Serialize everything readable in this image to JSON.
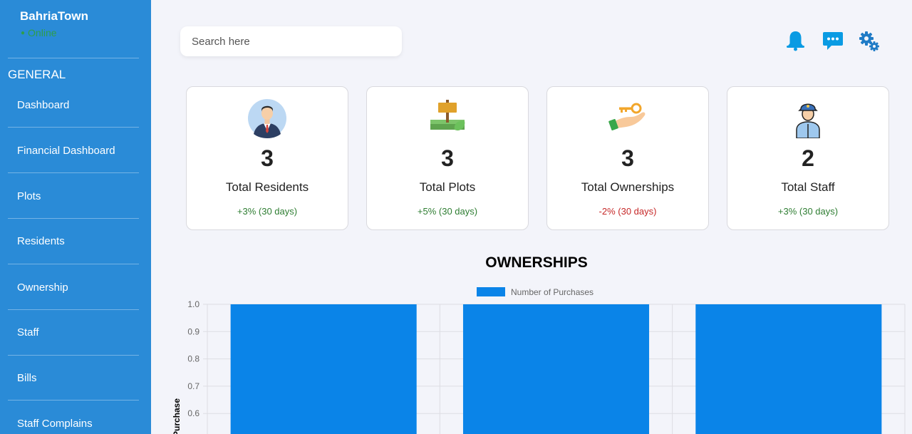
{
  "sidebar": {
    "brand": "BahriaTown",
    "status": "Online",
    "section": "GENERAL",
    "items": [
      {
        "label": "Dashboard"
      },
      {
        "label": "Financial Dashboard"
      },
      {
        "label": "Plots"
      },
      {
        "label": "Residents"
      },
      {
        "label": "Ownership"
      },
      {
        "label": "Staff"
      },
      {
        "label": "Bills"
      },
      {
        "label": "Staff Complains"
      }
    ]
  },
  "header": {
    "search_placeholder": "Search here",
    "icons": [
      "bell-icon",
      "chat-icon",
      "gears-icon"
    ],
    "icon_color": "#0a9be3"
  },
  "stats": [
    {
      "value": "3",
      "label": "Total Residents",
      "change": "+3% (30 days)",
      "trend": "up",
      "icon": "resident-avatar-icon"
    },
    {
      "value": "3",
      "label": "Total Plots",
      "change": "+5% (30 days)",
      "trend": "up",
      "icon": "plot-sign-icon"
    },
    {
      "value": "3",
      "label": "Total Ownerships",
      "change": "-2% (30 days)",
      "trend": "down",
      "icon": "hand-key-icon"
    },
    {
      "value": "2",
      "label": "Total Staff",
      "change": "+3% (30 days)",
      "trend": "up",
      "icon": "staff-guard-icon"
    }
  ],
  "colors": {
    "sidebar": "#2a8bd7",
    "positive": "#2e7d32",
    "negative": "#c62828",
    "bar": "#0a84e8"
  },
  "chart_data": {
    "type": "bar",
    "title": "OWNERSHIPS",
    "categories": [
      "",
      "",
      ""
    ],
    "series": [
      {
        "name": "Number of Purchases",
        "values": [
          1,
          1,
          1
        ]
      }
    ],
    "ylabel": "Purchase",
    "ylim": [
      0,
      1.0
    ],
    "y_ticks": [
      "1.0",
      "0.9",
      "0.8",
      "0.7",
      "0.6"
    ],
    "grid": true,
    "legend": "top-center"
  }
}
